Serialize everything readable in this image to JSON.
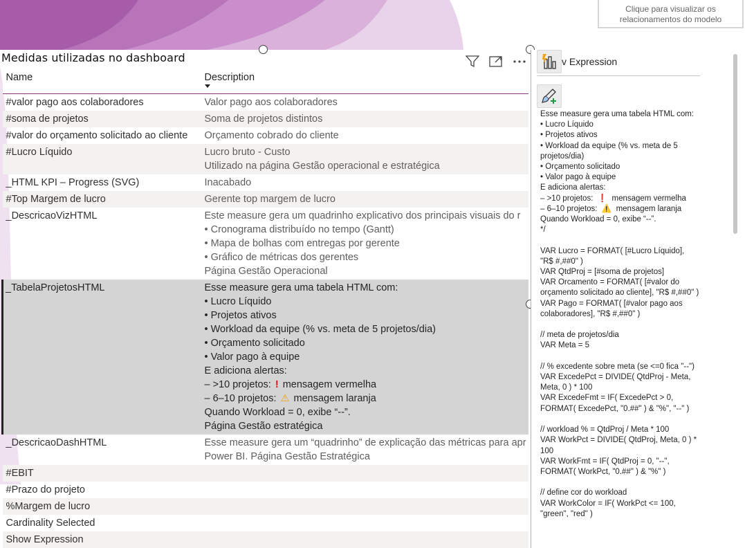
{
  "header": {
    "model_button_line1": "Clique para visualizar os",
    "model_button_line2": "relacionamentos do modelo"
  },
  "table_visual": {
    "title": "Medidas utilizadas no dashboard",
    "icons": [
      "filter-icon",
      "focus-mode-icon",
      "more-options-icon"
    ],
    "columns": [
      "Name",
      "Description"
    ],
    "rows": [
      {
        "name": "#valor pago aos colaboradores",
        "desc": [
          "Valor pago aos colaboradores"
        ]
      },
      {
        "name": "#soma de projetos",
        "desc": [
          "Soma de projetos distintos"
        ]
      },
      {
        "name": "#valor do orçamento solicitado ao cliente",
        "desc": [
          "Orçamento cobrado do cliente"
        ]
      },
      {
        "name": "#Lucro Líquido",
        "desc": [
          "Lucro bruto - Custo",
          "Utilizado na página Gestão operacional e estratégica"
        ]
      },
      {
        "name": "_HTML KPI – Progress (SVG)",
        "desc": [
          "Inacabado"
        ]
      },
      {
        "name": "#Top Margem de lucro",
        "desc": [
          "Gerente top margem de lucro"
        ]
      },
      {
        "name": "_DescricaoVizHTML",
        "desc": [
          "Este measure gera um quadrinho explicativo dos principais visuais do r",
          "• Cronograma distribuído no tempo (Gantt)",
          "• Mapa de bolhas com entregas por gerente",
          "• Gráfico de métricas dos gerentes",
          "Página Gestão Operacional"
        ]
      },
      {
        "name": "_TabelaProjetosHTML",
        "desc": [
          "Esse measure gera uma tabela HTML com:",
          "• Lucro Líquido",
          "• Projetos ativos",
          "• Workload da equipe (% vs. meta de 5 projetos/dia)",
          "• Orçamento solicitado",
          "• Valor pago à equipe",
          "E adiciona alertas:",
          "– >10 projetos:",
          "– 6–10 projetos:",
          "Quando Workload = 0, exibe “--”.",
          "Página Gestão estratégica"
        ],
        "alert_red": "mensagem vermelha",
        "alert_orange": "mensagem laranja"
      },
      {
        "name": "_DescricaoDashHTML",
        "desc": [
          "Esse measure gera um “quadrinho” de explicação das métricas para apr",
          "Power BI. Página Gestão Estratégica"
        ]
      },
      {
        "name": "#EBIT",
        "desc": []
      },
      {
        "name": "#Prazo do projeto",
        "desc": []
      },
      {
        "name": "%Margem de lucro",
        "desc": []
      },
      {
        "name": "Cardinality Selected",
        "desc": []
      },
      {
        "name": "Show Expression",
        "desc": []
      }
    ]
  },
  "side_panel": {
    "title": "Expression",
    "title_prefix": "v",
    "text": "Esse measure gera uma tabela HTML com:\n• Lucro Líquido\n• Projetos ativos\n• Workload da equipe (% vs. meta de 5 projetos/dia)\n• Orçamento solicitado\n• Valor pago à equipe\nE adiciona alertas:\n– >10 projetos:  ❗  mensagem vermelha\n– 6–10 projetos:  ⚠️  mensagem laranja\nQuando Workload = 0, exibe “--”.\n*/\n\nVAR Lucro = FORMAT( [#Lucro Líquido], \"R$ #,##0\" )\nVAR QtdProj = [#soma de projetos]\nVAR Orcamento = FORMAT( [#valor do orçamento solicitado ao cliente], \"R$ #,##0\" )\nVAR Pago = FORMAT( [#valor pago aos colaboradores], \"R$ #,##0\" )\n\n// meta de projetos/dia\nVAR Meta = 5\n\n// % excedente sobre meta (se <=0 fica \"--\")\nVAR ExcedePct = DIVIDE( QtdProj - Meta, Meta, 0 ) * 100\nVAR ExcedeFmt = IF( ExcedePct > 0, FORMAT( ExcedePct, \"0.##\" ) & \"%\", \"--\" )\n\n// workload % = QtdProj / Meta * 100\nVAR WorkPct = DIVIDE( QtdProj, Meta, 0 ) * 100\nVAR WorkFmt = IF( QtdProj = 0, \"--\", FORMAT( WorkPct, \"0.##\" ) & \"%\" )\n\n// define cor do workload\nVAR WorkColor = IF( WorkPct <= 100, \"green\", \"red\" )"
  },
  "colors": {
    "accent": "#8a3a7b",
    "selected_row": "#d4d4d4",
    "alt_row": "#f3f2f1"
  }
}
